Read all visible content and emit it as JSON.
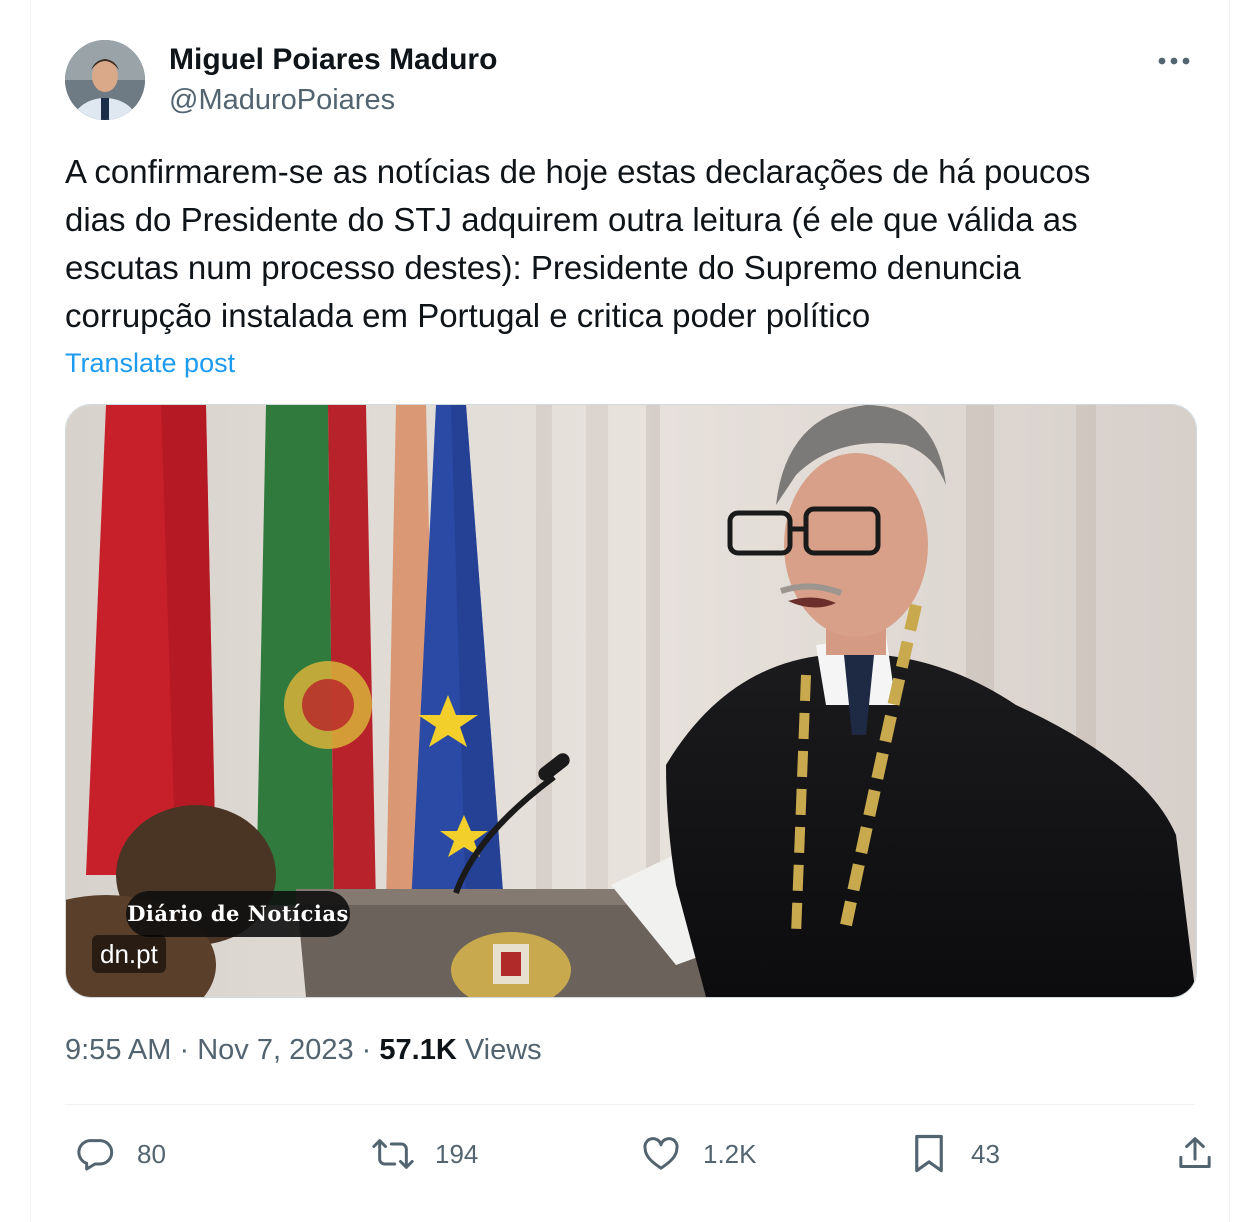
{
  "author": {
    "name": "Miguel Poiares Maduro",
    "handle": "@MaduroPoiares"
  },
  "tweet": {
    "text": "A confirmarem-se as notícias de hoje estas declarações de há poucos\ndias do Presidente do STJ adquirem outra leitura (é ele que válida as\nescutas num processo destes): Presidente do Supremo denuncia\ncorrupção instalada em Portugal e critica poder político",
    "translate_label": "Translate post"
  },
  "media": {
    "masthead": "Diário de Notícias",
    "source": "dn.pt"
  },
  "meta": {
    "time": "9:55 AM",
    "separator": "·",
    "date": "Nov 7, 2023",
    "views_count": "57.1K",
    "views_label": "Views"
  },
  "actions": {
    "replies": "80",
    "reposts": "194",
    "likes": "1.2K",
    "bookmarks": "43"
  },
  "icons": {
    "more": "more-dots-icon",
    "reply": "reply-bubble-icon",
    "repost": "repost-icon",
    "like": "heart-icon",
    "bookmark": "bookmark-icon",
    "share": "share-icon"
  },
  "colors": {
    "link": "#1d9bf0",
    "secondary_text": "#536471",
    "primary_text": "#0f1419"
  }
}
